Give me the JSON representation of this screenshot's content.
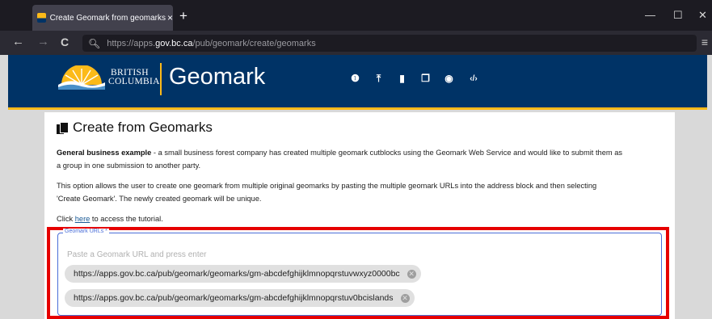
{
  "browser": {
    "tab_title": "Create Geomark from geomarks",
    "tab_close": "×",
    "new_tab": "+",
    "url_prefix": "https://apps.",
    "url_domain": "gov.bc.ca",
    "url_path": "/pub/geomark/create/geomarks",
    "win_minimize": "—",
    "win_maximize": "☐",
    "win_close": "✕",
    "back": "←",
    "forward": "→",
    "reload": "C",
    "menu": "≡"
  },
  "header": {
    "org_line1": "BRITISH",
    "org_line2": "COLUMBIA",
    "app_title": "Geomark",
    "icons": [
      "info-icon",
      "upload-icon",
      "clipboard-icon",
      "copy-icon",
      "globe-icon",
      "code-icon"
    ],
    "icon_glyphs": [
      "❶",
      "⤒",
      "▮",
      "❐",
      "◉",
      "‹/›"
    ]
  },
  "page": {
    "title": "Create from Geomarks",
    "example_bold": "General business example",
    "example_text_1": " - a small business forest company has created multiple geomark cutblocks using the Geomark Web Service and would like to submit them as",
    "example_text_2": "a group in one submission to another party.",
    "desc_line1": "This option allows the user to create one geomark from multiple original geomarks by pasting the multiple geomark URLs into the address block and then selecting",
    "desc_line2": "'Create Geomark'. The newly created geomark will be unique.",
    "tutorial_prefix": "Click ",
    "tutorial_link": "here",
    "tutorial_suffix": " to access the tutorial."
  },
  "form": {
    "field_label": "Geomark URLs *",
    "placeholder": "Paste a Geomark URL and press enter",
    "chips": [
      "https://apps.gov.bc.ca/pub/geomark/geomarks/gm-abcdefghijklmnopqrstuvwxyz0000bc",
      "https://apps.gov.bc.ca/pub/geomark/geomarks/gm-abcdefghijklmnopqrstuv0bcislands"
    ],
    "chip_remove": "✕"
  },
  "colors": {
    "bc_blue": "#003366",
    "bc_gold": "#fcba19",
    "highlight_red": "#e60000",
    "focus_blue": "#4a6ed8"
  }
}
